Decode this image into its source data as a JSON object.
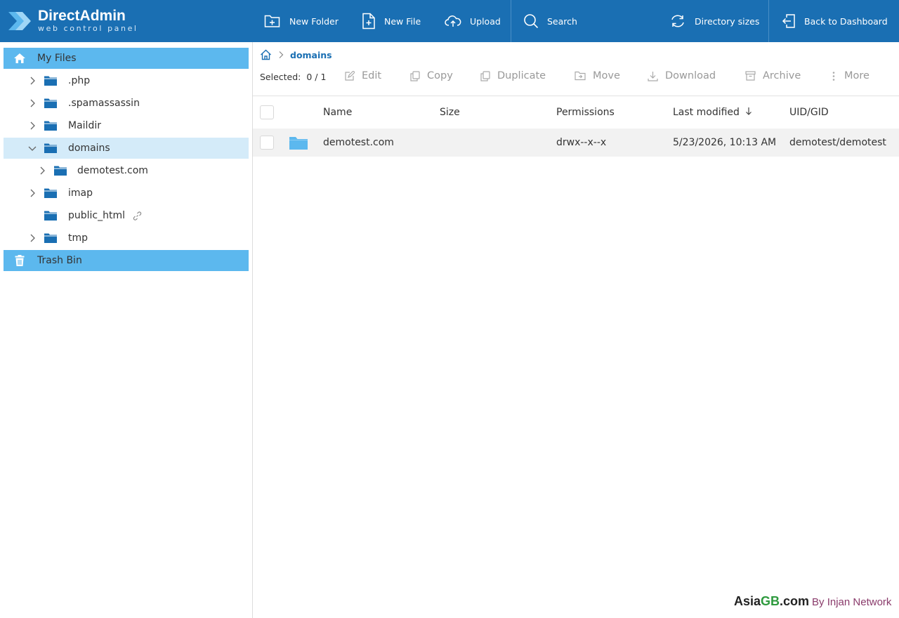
{
  "app": {
    "logo_name": "DirectAdmin",
    "logo_sub": "web control panel"
  },
  "toolbar": {
    "new_folder": "New Folder",
    "new_file": "New File",
    "upload": "Upload",
    "search": "Search",
    "directory_sizes": "Directory sizes",
    "back_to_dashboard": "Back to Dashboard"
  },
  "sidebar": {
    "root_label": "My Files",
    "items": [
      {
        "label": ".php"
      },
      {
        "label": ".spamassassin"
      },
      {
        "label": "Maildir"
      },
      {
        "label": "domains"
      },
      {
        "label": "demotest.com"
      },
      {
        "label": "imap"
      },
      {
        "label": "public_html"
      },
      {
        "label": "tmp"
      }
    ],
    "trash_label": "Trash Bin"
  },
  "breadcrumb": {
    "current": "domains"
  },
  "actions": {
    "selected_label": "Selected:",
    "selected_count": "0 / 1",
    "edit": "Edit",
    "copy": "Copy",
    "duplicate": "Duplicate",
    "move": "Move",
    "download": "Download",
    "archive": "Archive",
    "more": "More"
  },
  "table": {
    "columns": {
      "name": "Name",
      "size": "Size",
      "permissions": "Permissions",
      "last_modified": "Last modified",
      "uid_gid": "UID/GID"
    },
    "rows": [
      {
        "name": "demotest.com",
        "size": "",
        "permissions": "drwx--x--x",
        "last_modified": "5/23/2026, 10:13 AM",
        "uid_gid": "demotest/demotest"
      }
    ]
  },
  "watermark": {
    "part1": "Asia",
    "part2": "GB",
    "part3": ".com",
    "part4": "By Injan Network"
  },
  "colors": {
    "topbar": "#1a6fb3",
    "root_highlight": "#5cb8ee",
    "active_highlight": "#d4ebf9",
    "folder": "#1a6fb3",
    "folder_light": "#5cb8ee"
  }
}
